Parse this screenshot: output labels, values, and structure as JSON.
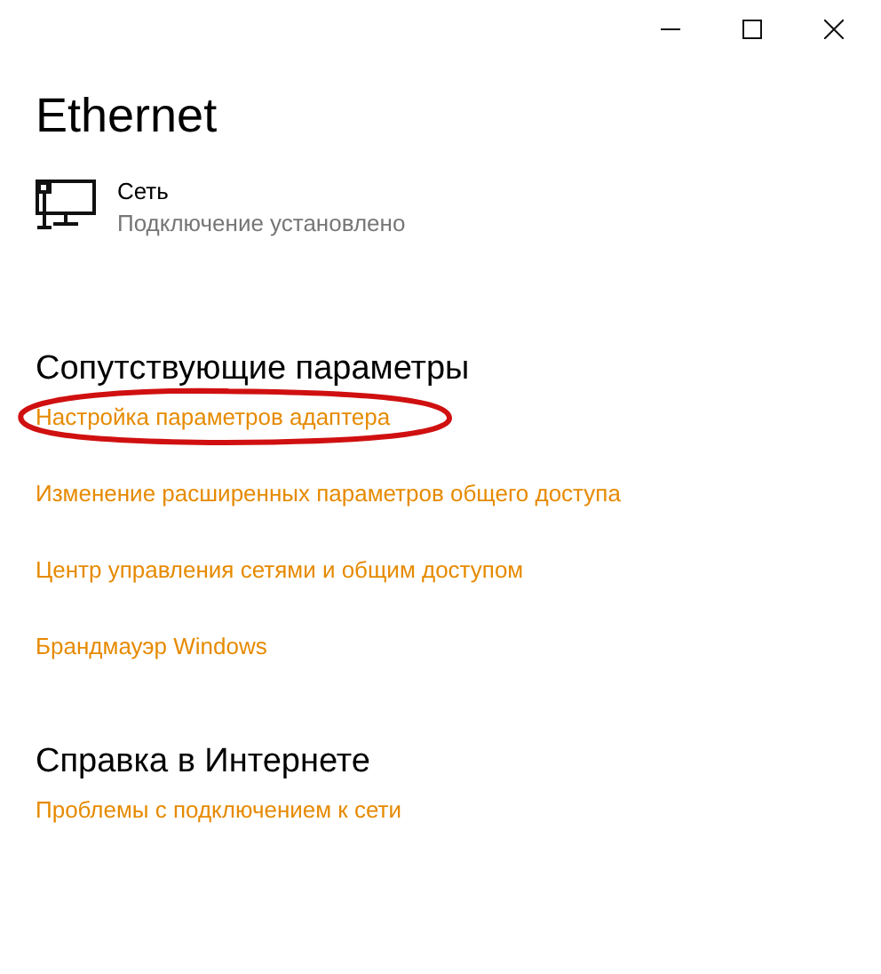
{
  "window": {
    "title": "Ethernet"
  },
  "network": {
    "name": "Сеть",
    "status": "Подключение установлено"
  },
  "sections": [
    {
      "heading": "Сопутствующие параметры",
      "links": [
        {
          "label": "Настройка параметров адаптера",
          "circled": true
        },
        {
          "label": "Изменение расширенных параметров общего доступа",
          "circled": false
        },
        {
          "label": "Центр управления сетями и общим доступом",
          "circled": false
        },
        {
          "label": "Брандмауэр Windows",
          "circled": false
        }
      ]
    },
    {
      "heading": "Справка в Интернете",
      "links": [
        {
          "label": "Проблемы с подключением к сети",
          "circled": false
        }
      ]
    }
  ]
}
